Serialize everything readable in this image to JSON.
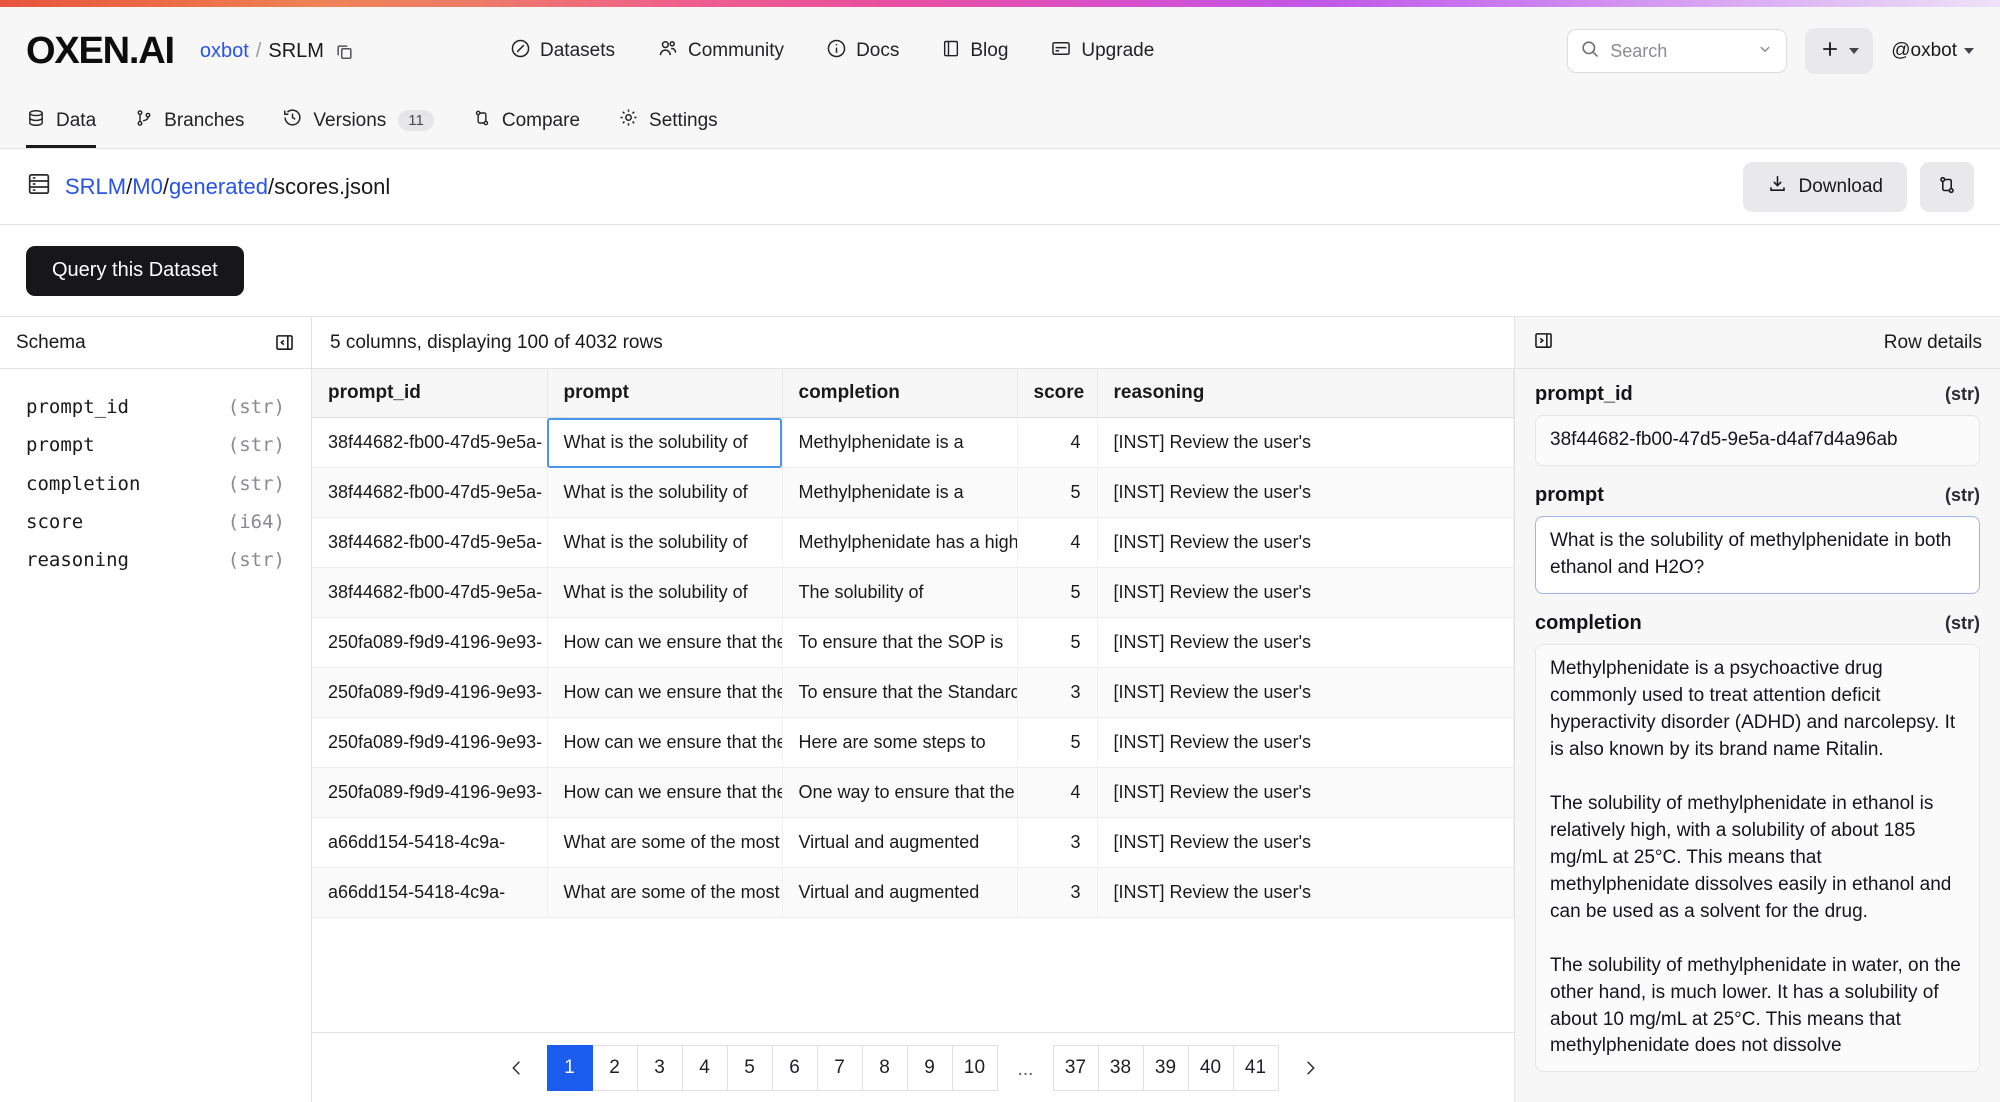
{
  "header": {
    "logo": "OXEN.AI",
    "breadcrumb": {
      "owner": "oxbot",
      "separator": "/",
      "repo": "SRLM",
      "copy_icon": "copy-icon"
    },
    "nav": [
      {
        "label": "Datasets",
        "icon": "compass-icon"
      },
      {
        "label": "Community",
        "icon": "users-icon"
      },
      {
        "label": "Docs",
        "icon": "info-circle-icon"
      },
      {
        "label": "Blog",
        "icon": "book-icon"
      },
      {
        "label": "Upgrade",
        "icon": "card-icon"
      }
    ],
    "search": {
      "placeholder": "Search",
      "icon": "search-icon",
      "chevron": "chevron-down-icon"
    },
    "add_button": {
      "icon": "plus-icon",
      "caret": "caret-down-icon"
    },
    "user": {
      "label": "@oxbot",
      "caret": "caret-down-icon"
    }
  },
  "tabs": [
    {
      "label": "Data",
      "icon": "database-icon",
      "active": true,
      "badge": ""
    },
    {
      "label": "Branches",
      "icon": "branch-icon",
      "active": false,
      "badge": ""
    },
    {
      "label": "Versions",
      "icon": "clock-history-icon",
      "active": false,
      "badge": "11"
    },
    {
      "label": "Compare",
      "icon": "compare-icon",
      "active": false,
      "badge": ""
    },
    {
      "label": "Settings",
      "icon": "gear-icon",
      "active": false,
      "badge": ""
    }
  ],
  "file_path": {
    "icon": "file-table-icon",
    "segments": [
      {
        "text": "SRLM",
        "link": true
      },
      {
        "text": "/",
        "link": false
      },
      {
        "text": "M0",
        "link": true
      },
      {
        "text": "/",
        "link": false
      },
      {
        "text": "generated",
        "link": true
      },
      {
        "text": "/scores.jsonl",
        "link": false
      }
    ],
    "download_label": "Download",
    "download_icon": "download-icon",
    "branch_button_icon": "compare-branch-icon"
  },
  "query_button": {
    "label": "Query this Dataset"
  },
  "schema": {
    "title": "Schema",
    "collapse_icon": "panel-collapse-left-icon",
    "fields": [
      {
        "name": "prompt_id",
        "type": "(str)"
      },
      {
        "name": "prompt",
        "type": "(str)"
      },
      {
        "name": "completion",
        "type": "(str)"
      },
      {
        "name": "score",
        "type": "(i64)"
      },
      {
        "name": "reasoning",
        "type": "(str)"
      }
    ]
  },
  "table": {
    "meta": "5 columns, displaying 100 of 4032 rows",
    "columns": [
      "prompt_id",
      "prompt",
      "completion",
      "score",
      "reasoning"
    ],
    "rows": [
      [
        "38f44682-fb00-47d5-9e5a-",
        "What is the solubility of",
        "Methylphenidate is a",
        "4",
        "[INST] Review the user's"
      ],
      [
        "38f44682-fb00-47d5-9e5a-",
        "What is the solubility of",
        "Methylphenidate is a",
        "5",
        "[INST] Review the user's"
      ],
      [
        "38f44682-fb00-47d5-9e5a-",
        "What is the solubility of",
        "Methylphenidate has a high",
        "4",
        "[INST] Review the user's"
      ],
      [
        "38f44682-fb00-47d5-9e5a-",
        "What is the solubility of",
        "The solubility of",
        "5",
        "[INST] Review the user's"
      ],
      [
        "250fa089-f9d9-4196-9e93-",
        "How can we ensure that the",
        "To ensure that the SOP is",
        "5",
        "[INST] Review the user's"
      ],
      [
        "250fa089-f9d9-4196-9e93-",
        "How can we ensure that the",
        "To ensure that the Standard",
        "3",
        "[INST] Review the user's"
      ],
      [
        "250fa089-f9d9-4196-9e93-",
        "How can we ensure that the",
        "Here are some steps to",
        "5",
        "[INST] Review the user's"
      ],
      [
        "250fa089-f9d9-4196-9e93-",
        "How can we ensure that the",
        "One way to ensure that the",
        "4",
        "[INST] Review the user's"
      ],
      [
        "a66dd154-5418-4c9a-",
        "What are some of the most",
        "Virtual and augmented",
        "3",
        "[INST] Review the user's"
      ],
      [
        "a66dd154-5418-4c9a-",
        "What are some of the most",
        "Virtual and augmented",
        "3",
        "[INST] Review the user's"
      ]
    ],
    "selected_cell": {
      "row": 0,
      "column": 1
    }
  },
  "pagination": {
    "prev_icon": "chevron-left-icon",
    "next_icon": "chevron-right-icon",
    "pages": [
      "1",
      "2",
      "3",
      "4",
      "5",
      "6",
      "7",
      "8",
      "9",
      "10"
    ],
    "ellipsis": "...",
    "tail_pages": [
      "37",
      "38",
      "39",
      "40",
      "41"
    ],
    "current": "1"
  },
  "row_details": {
    "title": "Row details",
    "expand_icon": "panel-collapse-right-icon",
    "fields": [
      {
        "label": "prompt_id",
        "type": "(str)",
        "value": "38f44682-fb00-47d5-9e5a-d4af7d4a96ab",
        "highlight": false
      },
      {
        "label": "prompt",
        "type": "(str)",
        "value": "What is the solubility of methylphenidate in both ethanol and H2O?",
        "highlight": true
      },
      {
        "label": "completion",
        "type": "(str)",
        "value": "Methylphenidate is a psychoactive drug commonly used to treat attention deficit hyperactivity disorder (ADHD) and narcolepsy. It is also known by its brand name Ritalin.\n\nThe solubility of methylphenidate in ethanol is relatively high, with a solubility of about 185 mg/mL at 25°C. This means that methylphenidate dissolves easily in ethanol and can be used as a solvent for the drug.\n\nThe solubility of methylphenidate in water, on the other hand, is much lower. It has a solubility of about 10 mg/mL at 25°C. This means that methylphenidate does not dissolve",
        "highlight": false
      }
    ]
  },
  "colors": {
    "accent_blue": "#1a5ced",
    "link_blue": "#2753e8",
    "dark_button": "#17171a",
    "selection_outline": "#4a96e8"
  }
}
